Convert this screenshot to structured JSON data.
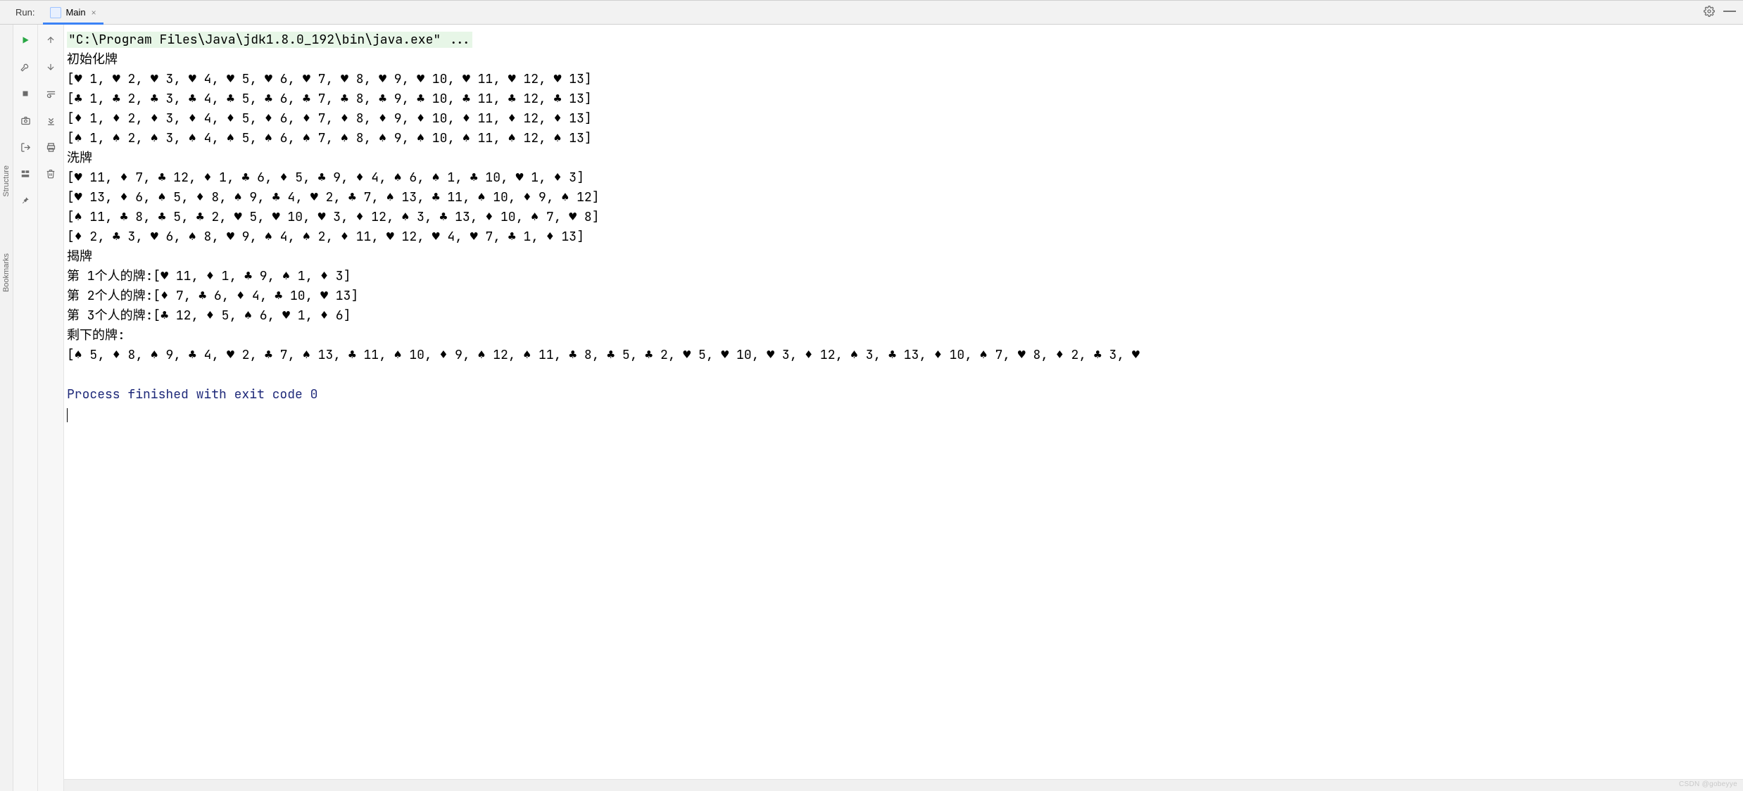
{
  "titlebar": {
    "run_label": "Run:",
    "tab_name": "Main",
    "tab_close_glyph": "×",
    "gear_icon": "gear-icon",
    "minimize_glyph": "—"
  },
  "left_sidebar_labels": {
    "structure": "Structure",
    "bookmarks": "Bookmarks"
  },
  "gutter_left_icons": [
    "play",
    "wrench",
    "stop",
    "camera",
    "exit",
    "layout",
    "pin"
  ],
  "gutter_mid_icons": [
    "arrow-up",
    "arrow-down",
    "soft-wrap",
    "scroll-end",
    "printer",
    "trash"
  ],
  "console": {
    "command": "\"C:\\Program Files\\Java\\jdk1.8.0_192\\bin\\java.exe\" ...",
    "blocks": [
      {
        "label": "初始化牌",
        "lines": [
          "[♥ 1, ♥ 2, ♥ 3, ♥ 4, ♥ 5, ♥ 6, ♥ 7, ♥ 8, ♥ 9, ♥ 10, ♥ 11, ♥ 12, ♥ 13]",
          "[♣ 1, ♣ 2, ♣ 3, ♣ 4, ♣ 5, ♣ 6, ♣ 7, ♣ 8, ♣ 9, ♣ 10, ♣ 11, ♣ 12, ♣ 13]",
          "[♦ 1, ♦ 2, ♦ 3, ♦ 4, ♦ 5, ♦ 6, ♦ 7, ♦ 8, ♦ 9, ♦ 10, ♦ 11, ♦ 12, ♦ 13]",
          "[♠ 1, ♠ 2, ♠ 3, ♠ 4, ♠ 5, ♠ 6, ♠ 7, ♠ 8, ♠ 9, ♠ 10, ♠ 11, ♠ 12, ♠ 13]"
        ]
      },
      {
        "label": "洗牌",
        "lines": [
          "[♥ 11, ♦ 7, ♣ 12, ♦ 1, ♣ 6, ♦ 5, ♣ 9, ♦ 4, ♠ 6, ♠ 1, ♣ 10, ♥ 1, ♦ 3]",
          "[♥ 13, ♦ 6, ♠ 5, ♦ 8, ♠ 9, ♣ 4, ♥ 2, ♣ 7, ♠ 13, ♣ 11, ♠ 10, ♦ 9, ♠ 12]",
          "[♠ 11, ♣ 8, ♣ 5, ♣ 2, ♥ 5, ♥ 10, ♥ 3, ♦ 12, ♠ 3, ♣ 13, ♦ 10, ♠ 7, ♥ 8]",
          "[♦ 2, ♣ 3, ♥ 6, ♠ 8, ♥ 9, ♠ 4, ♠ 2, ♦ 11, ♥ 12, ♥ 4, ♥ 7, ♣ 1, ♦ 13]"
        ]
      },
      {
        "label": "揭牌",
        "lines": [
          "第 1个人的牌:[♥ 11, ♦ 1, ♣ 9, ♠ 1, ♦ 3]",
          "第 2个人的牌:[♦ 7, ♣ 6, ♦ 4, ♣ 10, ♥ 13]",
          "第 3个人的牌:[♣ 12, ♦ 5, ♠ 6, ♥ 1, ♦ 6]"
        ]
      },
      {
        "label": "剩下的牌:",
        "lines": [
          "[♠ 5, ♦ 8, ♠ 9, ♣ 4, ♥ 2, ♣ 7, ♠ 13, ♣ 11, ♠ 10, ♦ 9, ♠ 12, ♠ 11, ♣ 8, ♣ 5, ♣ 2, ♥ 5, ♥ 10, ♥ 3, ♦ 12, ♠ 3, ♣ 13, ♦ 10, ♠ 7, ♥ 8, ♦ 2, ♣ 3, ♥"
        ]
      }
    ],
    "exit_line": "Process finished with exit code 0"
  },
  "watermark": "CSDN @gobeyye"
}
